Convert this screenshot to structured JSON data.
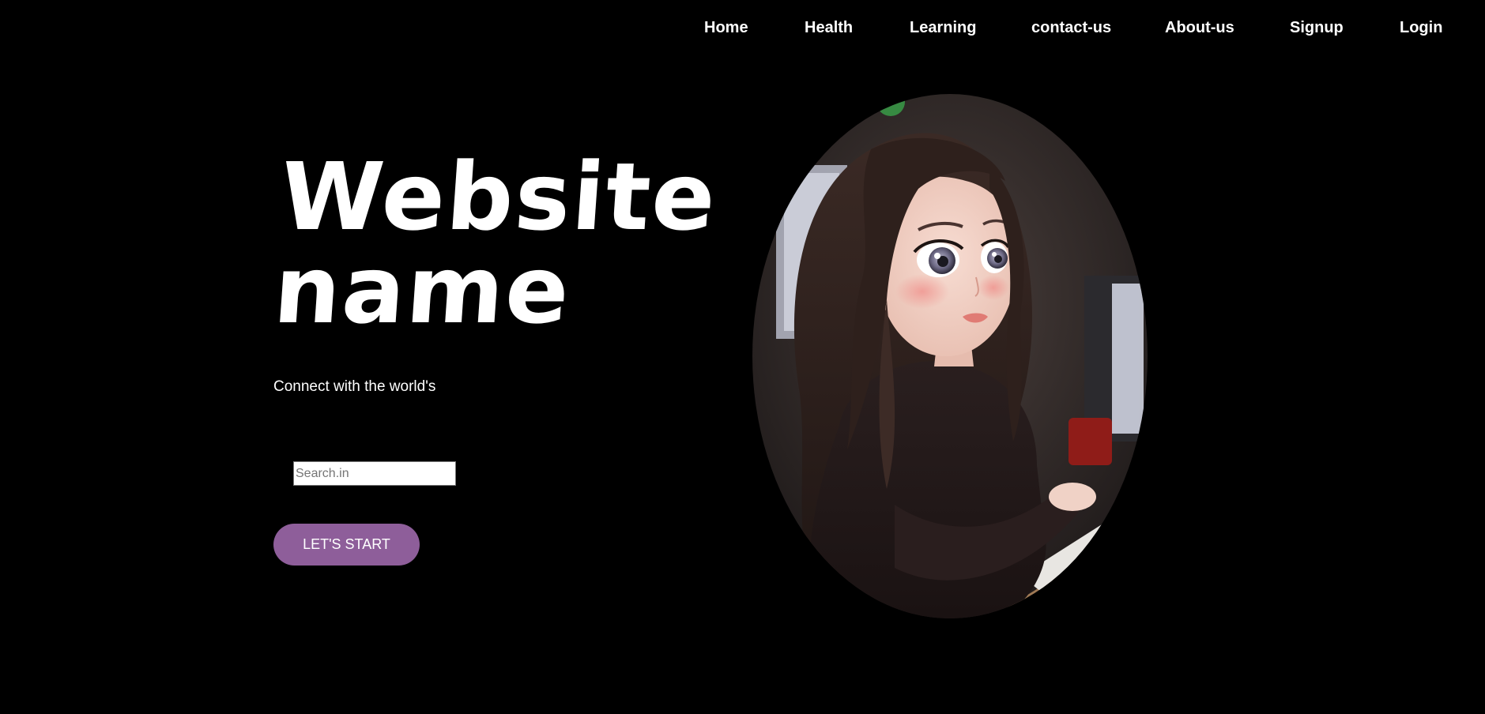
{
  "nav": {
    "items": [
      {
        "label": "Home"
      },
      {
        "label": "Health"
      },
      {
        "label": "Learning"
      },
      {
        "label": "contact-us"
      },
      {
        "label": "About-us"
      },
      {
        "label": "Signup"
      },
      {
        "label": "Login"
      }
    ]
  },
  "hero": {
    "title_line1": "Website",
    "title_line2": "name",
    "tagline": "Connect with the world's",
    "search": {
      "placeholder": "Search.in",
      "value": ""
    },
    "start_button_label": "LET'S START",
    "image": {
      "icon": "girl-at-computer-illustration"
    }
  },
  "colors": {
    "background": "#000000",
    "text": "#ffffff",
    "button": "#8e5e9a"
  }
}
